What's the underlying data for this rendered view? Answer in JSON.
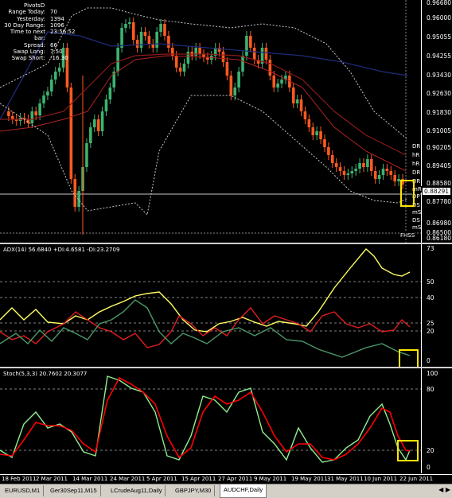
{
  "info": {
    "title": "PivotsD",
    "rows": [
      {
        "k": "Range  Today:",
        "v": "70"
      },
      {
        "k": "Yesterday:",
        "v": "1394"
      },
      {
        "k": "30 Day Range:",
        "v": "1096"
      },
      {
        "k": "Time to next bar:",
        "v": "23:56:52"
      },
      {
        "k": "Spread:",
        "v": "66"
      },
      {
        "k": "Swap  Long:",
        "v": "7.50"
      },
      {
        "k": "Swap  Short:",
        "v": "-16.30"
      }
    ]
  },
  "price_axis": [
    "0.96680",
    "0.96000",
    "0.95055",
    "0.94255",
    "0.93430",
    "0.92630",
    "0.91830",
    "0.91005",
    "0.90205",
    "0.89405",
    "0.88580",
    "0.88291",
    "0.87780",
    "0.86980",
    "0.86500",
    "0.86180"
  ],
  "pivot_labels": [
    "DR",
    "hR",
    "hR",
    "DR",
    "DR",
    "mR",
    "DP",
    "DS",
    "mS",
    "DS",
    "mS",
    "FHSS"
  ],
  "adx": {
    "title": "ADX(14) 56.6840 +DI:4.6581 -DI:23.2709",
    "axis": [
      "73",
      "50",
      "40",
      "25",
      "20",
      "0"
    ]
  },
  "stoch": {
    "title": "Stoch(5,3,3) 20.7602 20.3077",
    "axis": [
      "100",
      "80",
      "20",
      "0"
    ]
  },
  "dates": [
    "18 Feb 2011",
    "2 Mar 2011",
    "14 Mar 2011",
    "24 Mar 2011",
    "5 Apr 2011",
    "15 Apr 2011",
    "27 Apr 2011",
    "9 May 2011",
    "19 May 2011",
    "31 May 2011",
    "10 Jun 2011",
    "22 Jun 2011"
  ],
  "tabs": [
    {
      "label": "EURUSD,M1",
      "active": false
    },
    {
      "label": "Ger30Sep11,M15",
      "active": false
    },
    {
      "label": "LCrudeAug11,Daily",
      "active": false
    },
    {
      "label": "GBPJPY,M30",
      "active": false
    },
    {
      "label": "AUDCHF,Daily",
      "active": true
    }
  ],
  "colors": {
    "bull": "#3cb371",
    "bear": "#ff5a1e",
    "adx": "#ffff64",
    "plus_di": "#2e8b57",
    "minus_di": "#ff1e1e",
    "stoch_main": "#90ee90",
    "stoch_signal": "#ff0000",
    "highlight": "#ffe600"
  }
}
